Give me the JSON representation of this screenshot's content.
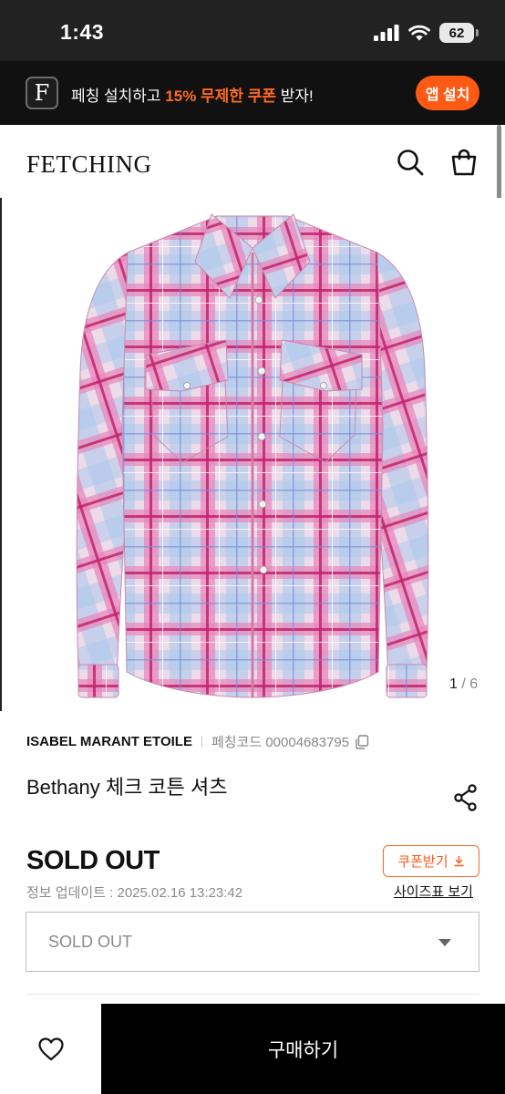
{
  "status_bar": {
    "time": "1:43",
    "battery": "62"
  },
  "app_banner": {
    "logo_letter": "F",
    "text_before": "페칭 설치하고 ",
    "text_highlight": "15% 무제한 쿠폰",
    "text_after": " 받자!",
    "install_label": "앱 설치"
  },
  "header": {
    "logo": "FETCHING"
  },
  "product": {
    "image_counter_current": "1",
    "image_counter_total": "6",
    "brand": "ISABEL MARANT ETOILE",
    "code_label": "페칭코드 00004683795",
    "title": "Bethany 체크 코튼 셔츠",
    "status": "SOLD OUT",
    "coupon_label": "쿠폰받기",
    "update_label": "정보 업데이트 : 2025.02.16 13:23:42",
    "size_chart_label": "사이즈표 보기",
    "option_value": "SOLD OUT"
  },
  "bottom_bar": {
    "buy_label": "구매하기"
  },
  "colors": {
    "accent": "#ff5a14",
    "banner_bg": "#111111",
    "buy_bg": "#000000"
  }
}
